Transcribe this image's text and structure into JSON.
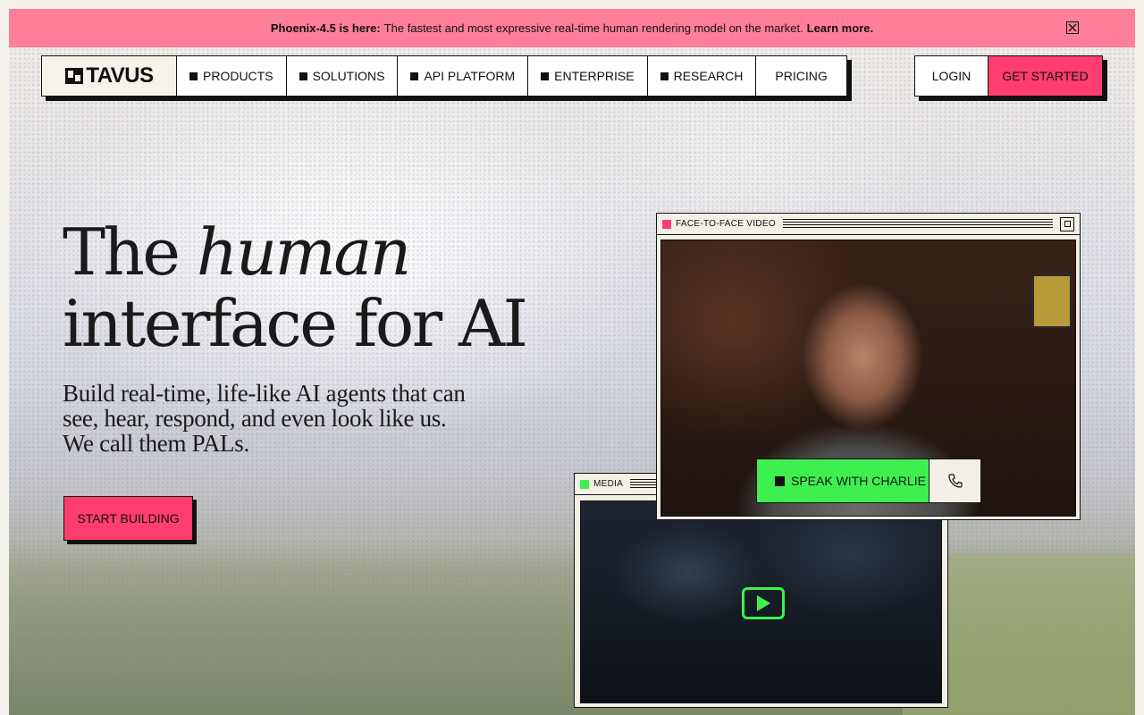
{
  "banner": {
    "lead": "Phoenix-4.5 is here:",
    "message": "The fastest and most expressive real-time human rendering model on the market.",
    "link": "Learn more."
  },
  "nav": {
    "logo_text": "TAVUS",
    "items": [
      {
        "label": "PRODUCTS"
      },
      {
        "label": "SOLUTIONS"
      },
      {
        "label": "API PLATFORM"
      },
      {
        "label": "ENTERPRISE"
      },
      {
        "label": "RESEARCH"
      },
      {
        "label": "PRICING"
      }
    ],
    "login": "LOGIN",
    "get_started": "GET STARTED"
  },
  "hero": {
    "headline_1a": "The",
    "headline_1b": "human",
    "headline_2": "interface for AI",
    "subhead": "Build real-time, life-like AI agents that can see, hear, respond, and even look like us. We call them PALs.",
    "cta": "START BUILDING"
  },
  "video_window": {
    "title": "FACE-TO-FACE VIDEO",
    "speak_label": "SPEAK WITH CHARLIE"
  },
  "media_window": {
    "title": "MEDIA"
  },
  "colors": {
    "banner": "#ff7e9a",
    "accent_pink": "#ff3d6e",
    "accent_green": "#3df04f",
    "ink": "#111111"
  }
}
